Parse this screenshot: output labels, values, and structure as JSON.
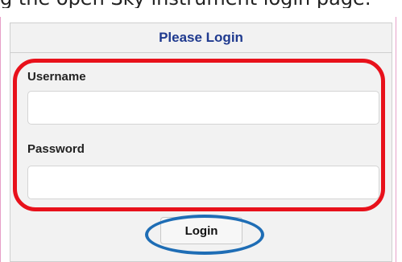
{
  "caption": "g the open Sky instrument login page.",
  "panel": {
    "title": "Please Login"
  },
  "form": {
    "username_label": "Username",
    "username_value": "",
    "password_label": "Password",
    "password_value": ""
  },
  "actions": {
    "login_label": "Login"
  },
  "annotations": {
    "fields_highlight_color": "#e8111b",
    "button_highlight_color": "#1e6db5"
  }
}
